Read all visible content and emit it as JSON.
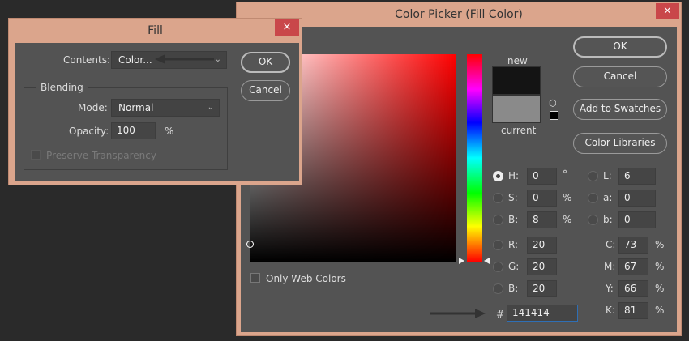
{
  "color_picker": {
    "title": "Color Picker (Fill Color)",
    "close_icon": "×",
    "new_label": "new",
    "current_label": "current",
    "new_color": "#141414",
    "current_color": "#8a8a8a",
    "buttons": {
      "ok": "OK",
      "cancel": "Cancel",
      "add_swatches": "Add to Swatches",
      "color_libraries": "Color Libraries"
    },
    "only_web_colors": "Only Web Colors",
    "fields": {
      "H": {
        "label": "H:",
        "value": "0",
        "unit": "°"
      },
      "S": {
        "label": "S:",
        "value": "0",
        "unit": "%"
      },
      "Bv": {
        "label": "B:",
        "value": "8",
        "unit": "%"
      },
      "R": {
        "label": "R:",
        "value": "20"
      },
      "G": {
        "label": "G:",
        "value": "20"
      },
      "Bl": {
        "label": "B:",
        "value": "20"
      },
      "L": {
        "label": "L:",
        "value": "6"
      },
      "a": {
        "label": "a:",
        "value": "0"
      },
      "b": {
        "label": "b:",
        "value": "0"
      },
      "C": {
        "label": "C:",
        "value": "73",
        "unit": "%"
      },
      "M": {
        "label": "M:",
        "value": "67",
        "unit": "%"
      },
      "Y": {
        "label": "Y:",
        "value": "66",
        "unit": "%"
      },
      "K": {
        "label": "K:",
        "value": "81",
        "unit": "%"
      }
    },
    "hex_label": "#",
    "hex_value": "141414"
  },
  "fill": {
    "title": "Fill",
    "close_icon": "×",
    "contents_label": "Contents:",
    "contents_value": "Color...",
    "ok": "OK",
    "cancel": "Cancel",
    "blending_label": "Blending",
    "mode_label": "Mode:",
    "mode_value": "Normal",
    "opacity_label": "Opacity:",
    "opacity_value": "100",
    "opacity_unit": "%",
    "preserve_transparency": "Preserve Transparency"
  }
}
